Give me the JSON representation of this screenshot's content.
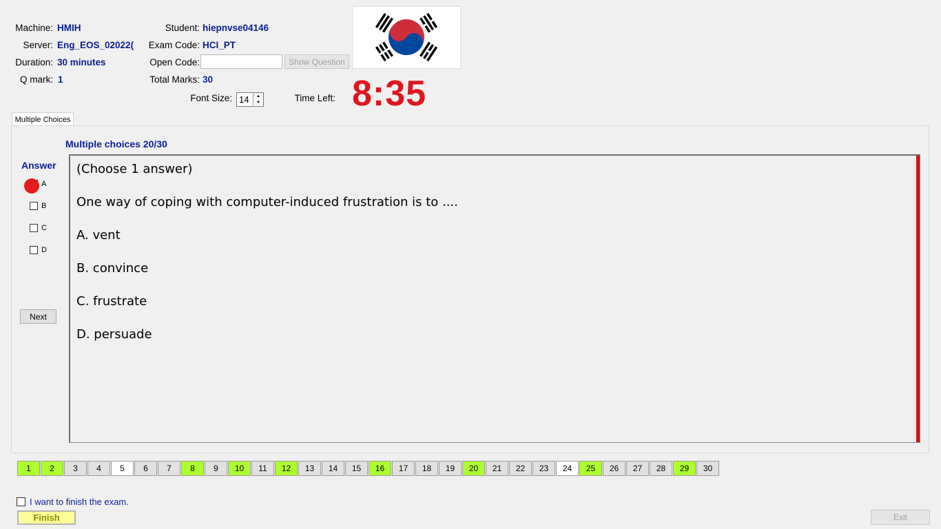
{
  "info": {
    "machine_label": "Machine:",
    "machine_value": "HMIH",
    "server_label": "Server:",
    "server_value": "Eng_EOS_02022(",
    "duration_label": "Duration:",
    "duration_value": "30 minutes",
    "qmark_label": "Q mark:",
    "qmark_value": "1",
    "student_label": "Student:",
    "student_value": "hiepnvse04146",
    "exam_code_label": "Exam Code:",
    "exam_code_value": "HCI_PT",
    "open_code_label": "Open Code:",
    "open_code_value": "",
    "total_marks_label": "Total Marks:",
    "total_marks_value": "30",
    "font_size_label": "Font Size:",
    "font_size_value": "14",
    "time_left_label": "Time Left:",
    "time_left_value": "8:35",
    "show_question_label": "Show Question",
    "flag_icon": "south-korea-flag"
  },
  "tab": {
    "label": "Multiple Choices"
  },
  "question": {
    "header": "Multiple choices 20/30",
    "lines": [
      "(Choose 1 answer)",
      "One way of coping with computer-induced frustration is to ....",
      "A.  vent",
      "B.  convince",
      "C.  frustrate",
      "D.  persuade"
    ]
  },
  "answer": {
    "title": "Answer",
    "options": [
      {
        "label": "A",
        "checked": true
      },
      {
        "label": "B",
        "checked": false
      },
      {
        "label": "C",
        "checked": false
      },
      {
        "label": "D",
        "checked": false
      }
    ],
    "next_label": "Next"
  },
  "nav": {
    "numbers": [
      "1",
      "2",
      "3",
      "4",
      "5",
      "6",
      "7",
      "8",
      "9",
      "10",
      "11",
      "12",
      "13",
      "14",
      "15",
      "16",
      "17",
      "18",
      "19",
      "20",
      "21",
      "22",
      "23",
      "24",
      "25",
      "26",
      "27",
      "28",
      "29",
      "30"
    ],
    "answered": [
      1,
      2,
      8,
      10,
      12,
      16,
      20,
      25,
      29
    ],
    "white": [
      5,
      24
    ]
  },
  "footer": {
    "finish_check_label": "I want to finish the exam.",
    "finish_label": "Finish",
    "exit_label": "Exit"
  },
  "colors": {
    "accent": "#0b1f8f",
    "timer": "#e0141e",
    "answered": "#adff2f",
    "finish_bg": "#ffff99"
  }
}
